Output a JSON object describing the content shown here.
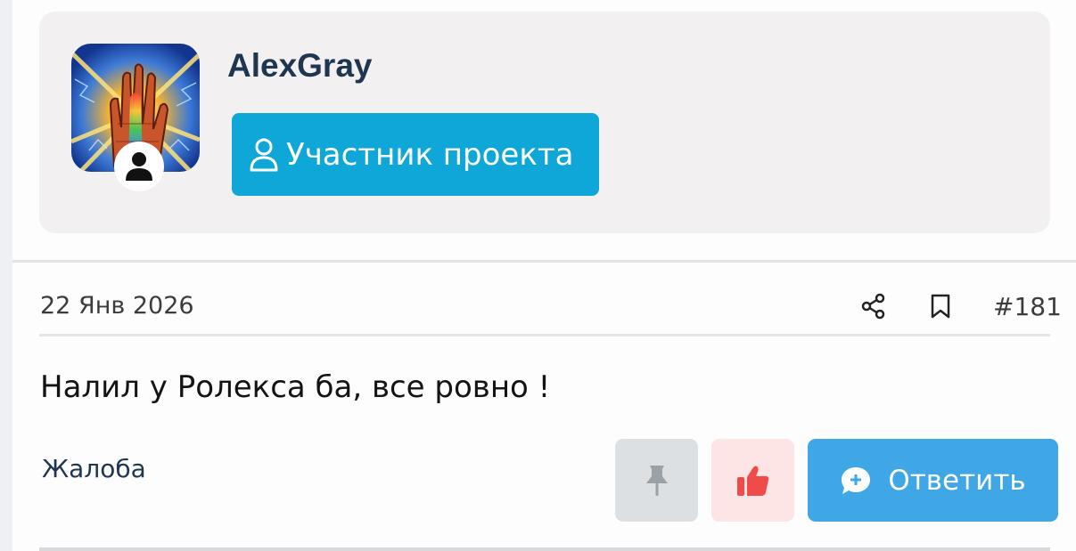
{
  "author": {
    "username": "AlexGray",
    "role": "Участник проекта",
    "avatar_icon": "psychedelic-hand-art-avatar",
    "badge_icon": "user-silhouette-icon"
  },
  "post": {
    "date": "22 Янв 2026",
    "number": "#181",
    "text": "Налил у Ролекса ба, все ровно !",
    "report_label": "Жалоба",
    "reply_label": "Ответить"
  },
  "colors": {
    "accent": "#0ea7d8",
    "reply": "#40a7e6",
    "like": "#f04b4b",
    "username": "#1f3650"
  }
}
